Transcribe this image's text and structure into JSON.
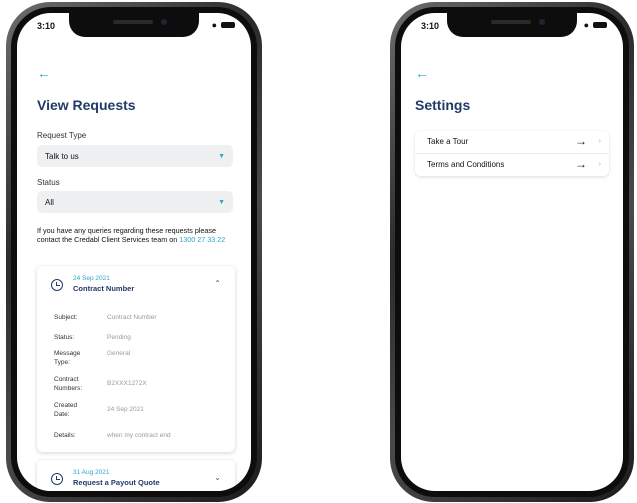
{
  "left_phone": {
    "status_time": "3:10",
    "back_icon": "arrow-left-icon",
    "title": "View Requests",
    "request_type": {
      "label": "Request Type",
      "value": "Talk to us"
    },
    "status": {
      "label": "Status",
      "value": "All"
    },
    "info": {
      "text": "If you have any queries regarding these requests please contact the Credabl Client Services team on ",
      "phone": "1300 27 33 22"
    },
    "requests": [
      {
        "date": "24 Sep 2021",
        "title": "Contract Number",
        "expanded": true,
        "details": [
          {
            "label": "Subject:",
            "value": "Contract Number"
          },
          {
            "label": "Status:",
            "value": "Pending"
          },
          {
            "label": "Message Type:",
            "value": "General"
          },
          {
            "label": "Contract Numbers:",
            "value": "B2XXX1272X"
          },
          {
            "label": "Created Date:",
            "value": "24 Sep 2021"
          },
          {
            "label": "Details:",
            "value": "when my contract end"
          }
        ]
      },
      {
        "date": "31 Aug 2021",
        "title": "Request a Payout Quote",
        "expanded": false
      }
    ]
  },
  "right_phone": {
    "status_time": "3:10",
    "back_icon": "arrow-left-icon",
    "title": "Settings",
    "items": [
      {
        "label": "Take a Tour"
      },
      {
        "label": "Terms and Conditions"
      }
    ]
  },
  "colors": {
    "accent": "#2ea7c9",
    "title": "#223a68",
    "select_bg": "#eef0f2"
  }
}
